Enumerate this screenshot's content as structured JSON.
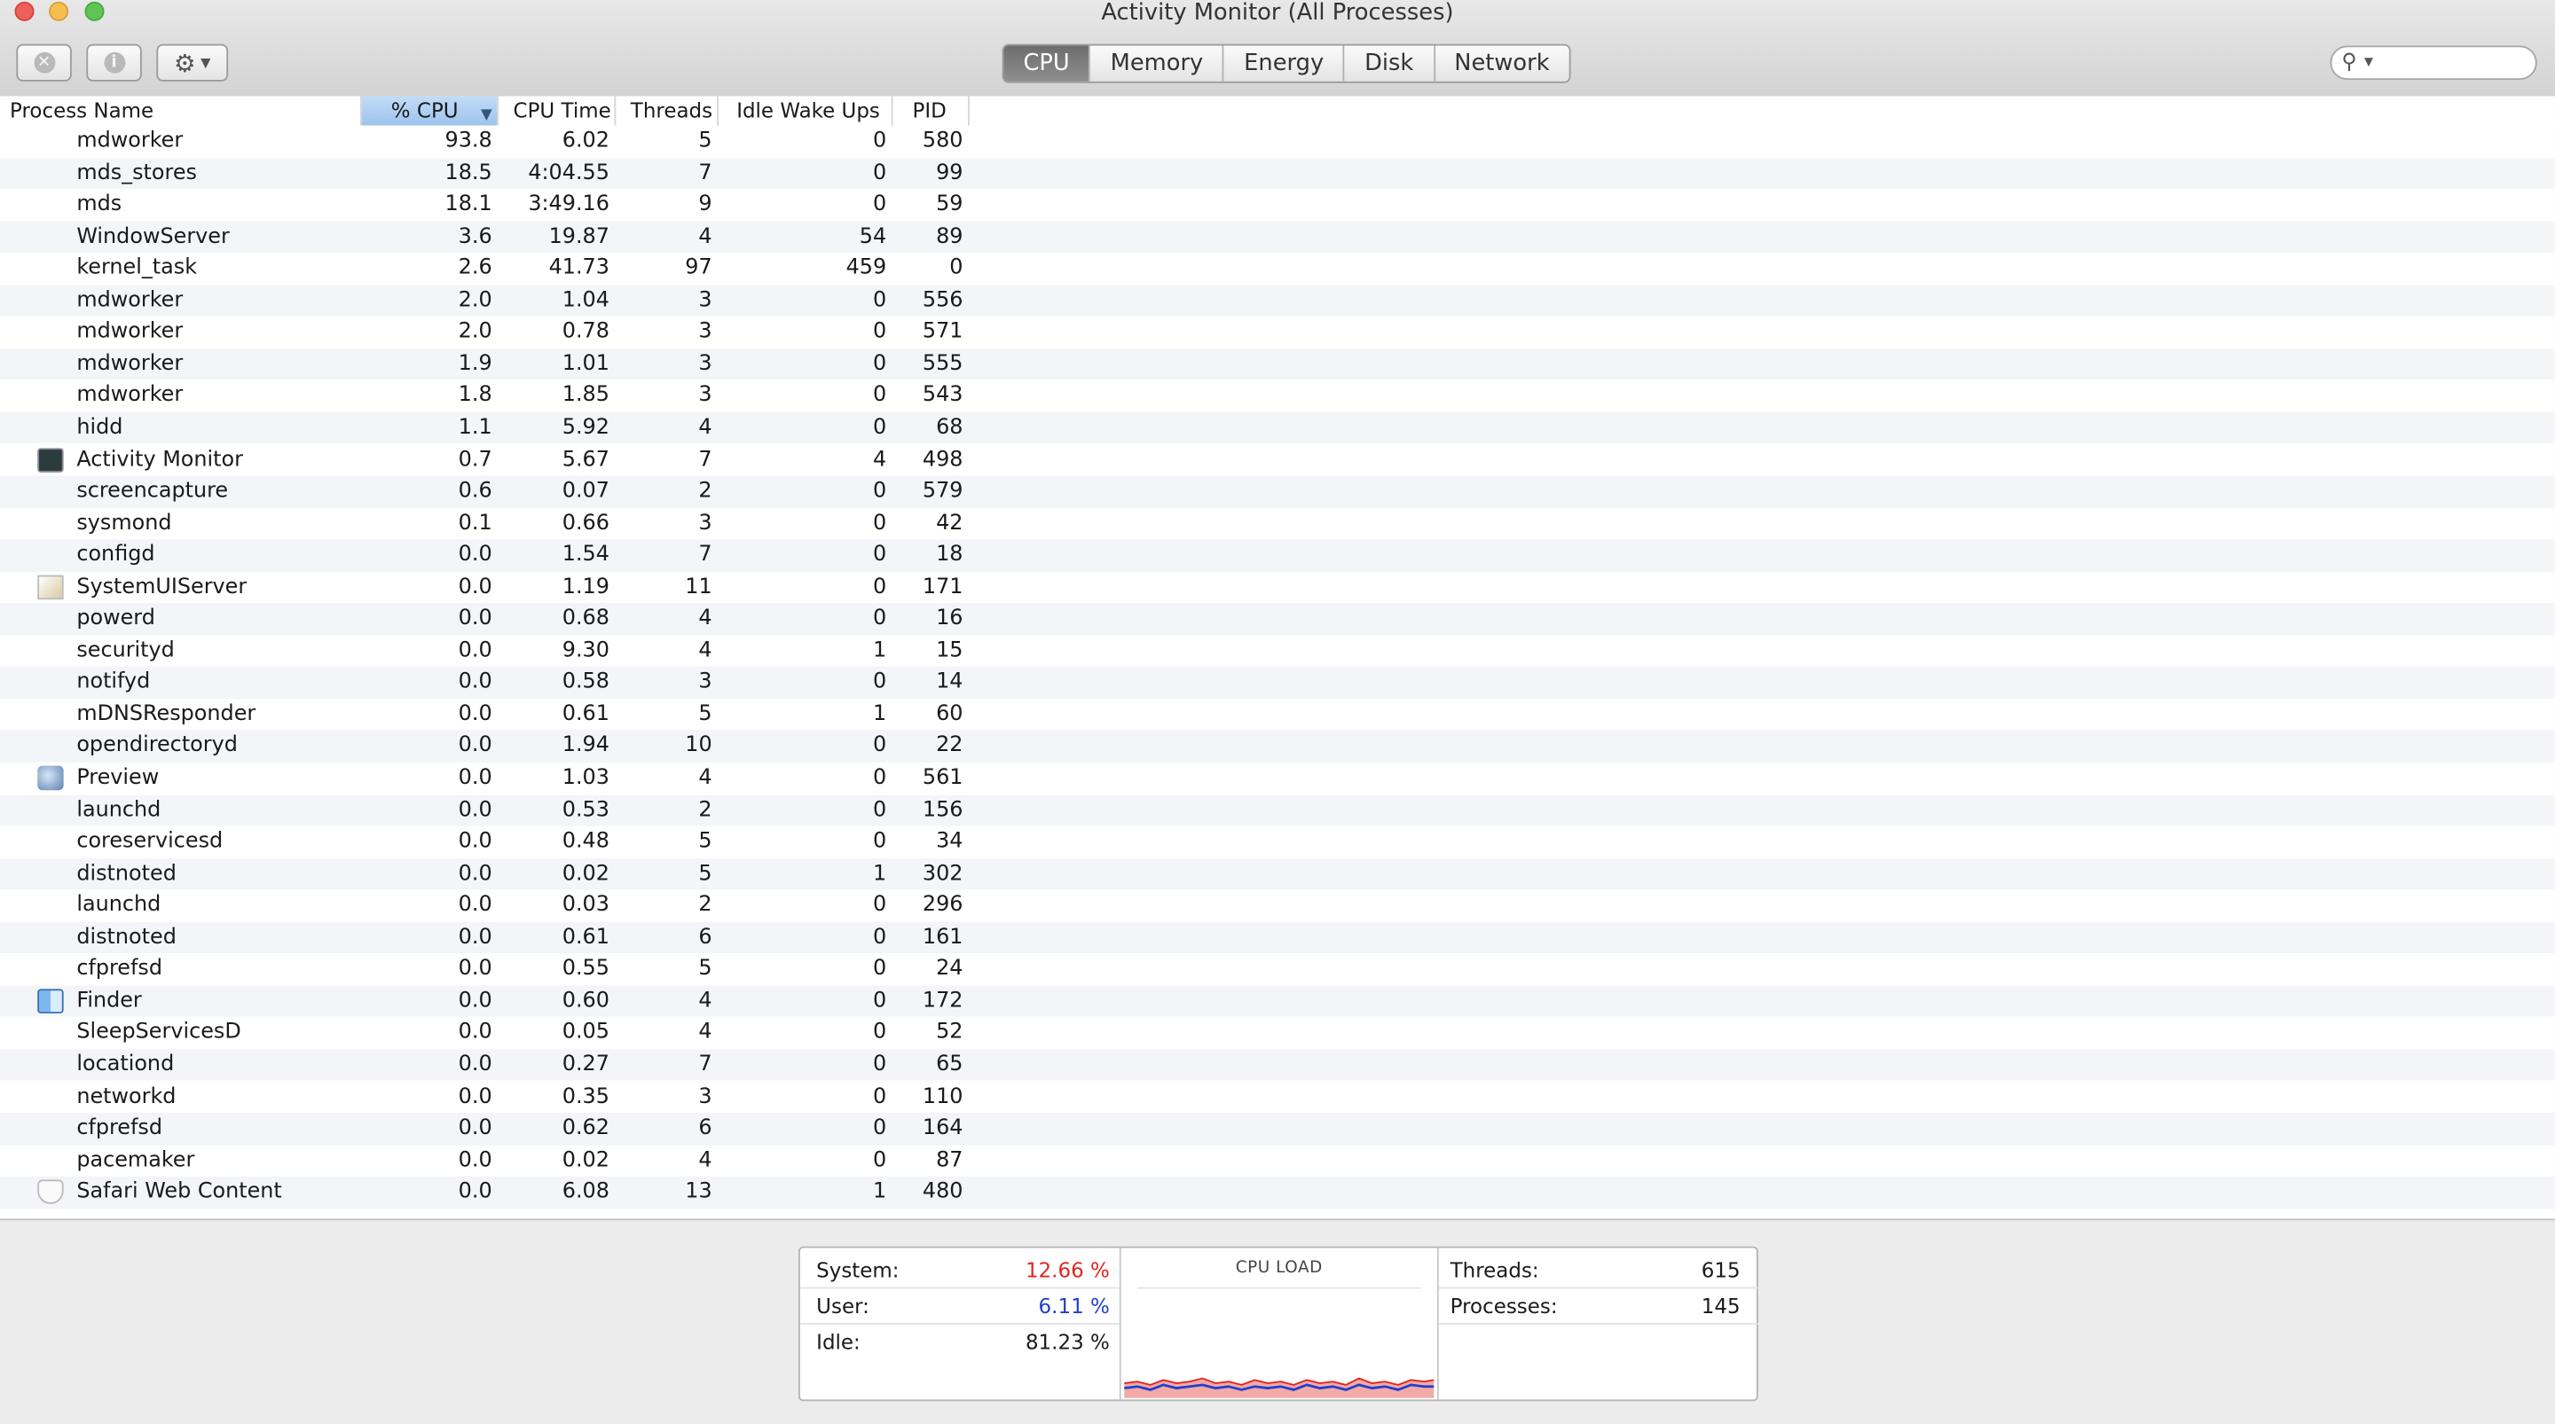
{
  "window": {
    "title": "Activity Monitor (All Processes)"
  },
  "toolbar": {
    "tabs": [
      "CPU",
      "Memory",
      "Energy",
      "Disk",
      "Network"
    ],
    "active_tab": "CPU",
    "stop_button_glyph": "✕",
    "info_button_glyph": "i",
    "action_button_glyph": "⚙"
  },
  "columns": {
    "name": "Process Name",
    "cpu": "% CPU",
    "cpu_time": "CPU Time",
    "threads": "Threads",
    "idle_wake_ups": "Idle Wake Ups",
    "pid": "PID"
  },
  "processes": [
    {
      "name": "mdworker",
      "cpu": "93.8",
      "time": "6.02",
      "threads": "5",
      "iwu": "0",
      "pid": "580",
      "icon": ""
    },
    {
      "name": "mds_stores",
      "cpu": "18.5",
      "time": "4:04.55",
      "threads": "7",
      "iwu": "0",
      "pid": "99",
      "icon": ""
    },
    {
      "name": "mds",
      "cpu": "18.1",
      "time": "3:49.16",
      "threads": "9",
      "iwu": "0",
      "pid": "59",
      "icon": ""
    },
    {
      "name": "WindowServer",
      "cpu": "3.6",
      "time": "19.87",
      "threads": "4",
      "iwu": "54",
      "pid": "89",
      "icon": ""
    },
    {
      "name": "kernel_task",
      "cpu": "2.6",
      "time": "41.73",
      "threads": "97",
      "iwu": "459",
      "pid": "0",
      "icon": ""
    },
    {
      "name": "mdworker",
      "cpu": "2.0",
      "time": "1.04",
      "threads": "3",
      "iwu": "0",
      "pid": "556",
      "icon": ""
    },
    {
      "name": "mdworker",
      "cpu": "2.0",
      "time": "0.78",
      "threads": "3",
      "iwu": "0",
      "pid": "571",
      "icon": ""
    },
    {
      "name": "mdworker",
      "cpu": "1.9",
      "time": "1.01",
      "threads": "3",
      "iwu": "0",
      "pid": "555",
      "icon": ""
    },
    {
      "name": "mdworker",
      "cpu": "1.8",
      "time": "1.85",
      "threads": "3",
      "iwu": "0",
      "pid": "543",
      "icon": ""
    },
    {
      "name": "hidd",
      "cpu": "1.1",
      "time": "5.92",
      "threads": "4",
      "iwu": "0",
      "pid": "68",
      "icon": ""
    },
    {
      "name": "Activity Monitor",
      "cpu": "0.7",
      "time": "5.67",
      "threads": "7",
      "iwu": "4",
      "pid": "498",
      "icon": "activity-monitor-icon"
    },
    {
      "name": "screencapture",
      "cpu": "0.6",
      "time": "0.07",
      "threads": "2",
      "iwu": "0",
      "pid": "579",
      "icon": ""
    },
    {
      "name": "sysmond",
      "cpu": "0.1",
      "time": "0.66",
      "threads": "3",
      "iwu": "0",
      "pid": "42",
      "icon": ""
    },
    {
      "name": "configd",
      "cpu": "0.0",
      "time": "1.54",
      "threads": "7",
      "iwu": "0",
      "pid": "18",
      "icon": ""
    },
    {
      "name": "SystemUIServer",
      "cpu": "0.0",
      "time": "1.19",
      "threads": "11",
      "iwu": "0",
      "pid": "171",
      "icon": "systemuiserver-icon"
    },
    {
      "name": "powerd",
      "cpu": "0.0",
      "time": "0.68",
      "threads": "4",
      "iwu": "0",
      "pid": "16",
      "icon": ""
    },
    {
      "name": "securityd",
      "cpu": "0.0",
      "time": "9.30",
      "threads": "4",
      "iwu": "1",
      "pid": "15",
      "icon": ""
    },
    {
      "name": "notifyd",
      "cpu": "0.0",
      "time": "0.58",
      "threads": "3",
      "iwu": "0",
      "pid": "14",
      "icon": ""
    },
    {
      "name": "mDNSResponder",
      "cpu": "0.0",
      "time": "0.61",
      "threads": "5",
      "iwu": "1",
      "pid": "60",
      "icon": ""
    },
    {
      "name": "opendirectoryd",
      "cpu": "0.0",
      "time": "1.94",
      "threads": "10",
      "iwu": "0",
      "pid": "22",
      "icon": ""
    },
    {
      "name": "Preview",
      "cpu": "0.0",
      "time": "1.03",
      "threads": "4",
      "iwu": "0",
      "pid": "561",
      "icon": "preview-icon"
    },
    {
      "name": "launchd",
      "cpu": "0.0",
      "time": "0.53",
      "threads": "2",
      "iwu": "0",
      "pid": "156",
      "icon": ""
    },
    {
      "name": "coreservicesd",
      "cpu": "0.0",
      "time": "0.48",
      "threads": "5",
      "iwu": "0",
      "pid": "34",
      "icon": ""
    },
    {
      "name": "distnoted",
      "cpu": "0.0",
      "time": "0.02",
      "threads": "5",
      "iwu": "1",
      "pid": "302",
      "icon": ""
    },
    {
      "name": "launchd",
      "cpu": "0.0",
      "time": "0.03",
      "threads": "2",
      "iwu": "0",
      "pid": "296",
      "icon": ""
    },
    {
      "name": "distnoted",
      "cpu": "0.0",
      "time": "0.61",
      "threads": "6",
      "iwu": "0",
      "pid": "161",
      "icon": ""
    },
    {
      "name": "cfprefsd",
      "cpu": "0.0",
      "time": "0.55",
      "threads": "5",
      "iwu": "0",
      "pid": "24",
      "icon": ""
    },
    {
      "name": "Finder",
      "cpu": "0.0",
      "time": "0.60",
      "threads": "4",
      "iwu": "0",
      "pid": "172",
      "icon": "finder-icon"
    },
    {
      "name": "SleepServicesD",
      "cpu": "0.0",
      "time": "0.05",
      "threads": "4",
      "iwu": "0",
      "pid": "52",
      "icon": ""
    },
    {
      "name": "locationd",
      "cpu": "0.0",
      "time": "0.27",
      "threads": "7",
      "iwu": "0",
      "pid": "65",
      "icon": ""
    },
    {
      "name": "networkd",
      "cpu": "0.0",
      "time": "0.35",
      "threads": "3",
      "iwu": "0",
      "pid": "110",
      "icon": ""
    },
    {
      "name": "cfprefsd",
      "cpu": "0.0",
      "time": "0.62",
      "threads": "6",
      "iwu": "0",
      "pid": "164",
      "icon": ""
    },
    {
      "name": "pacemaker",
      "cpu": "0.0",
      "time": "0.02",
      "threads": "4",
      "iwu": "0",
      "pid": "87",
      "icon": ""
    },
    {
      "name": "Safari Web Content",
      "cpu": "0.0",
      "time": "6.08",
      "threads": "13",
      "iwu": "1",
      "pid": "480",
      "icon": "safari-web-content-icon"
    }
  ],
  "summary": {
    "system_label": "System:",
    "system_value": "12.66 %",
    "user_label": "User:",
    "user_value": "6.11 %",
    "idle_label": "Idle:",
    "idle_value": "81.23 %",
    "graph_title": "CPU LOAD",
    "threads_label": "Threads:",
    "threads_value": "615",
    "processes_label": "Processes:",
    "processes_value": "145"
  },
  "colors": {
    "system": "#e0261f",
    "user": "#1f3fd0",
    "sort_header": "#9dc3ee",
    "active_tab": "#7a7a7a"
  }
}
